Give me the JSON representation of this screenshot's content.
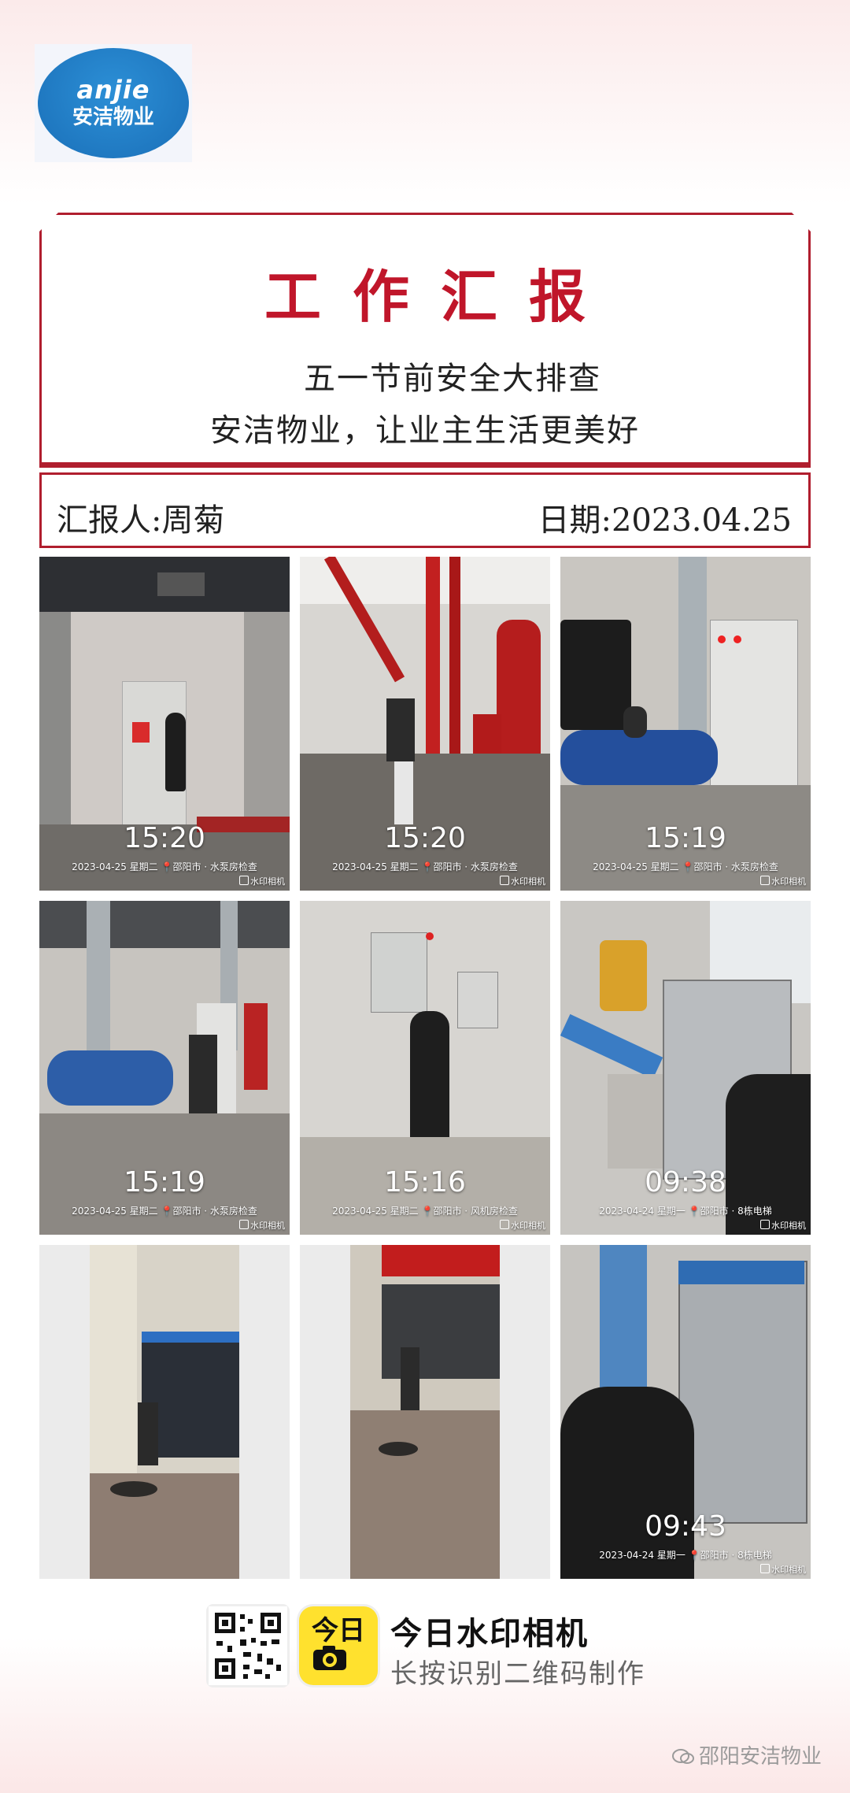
{
  "logo": {
    "en": "anjie",
    "cn": "安洁物业"
  },
  "report": {
    "title": "工作汇报",
    "subtitle": "五一节前安全大排查",
    "slogan": "安洁物业，让业主生活更美好",
    "reporter": "汇报人:周菊",
    "date": "日期:2023.04.25"
  },
  "photos": [
    {
      "time": "15:20",
      "date": "2023-04-25 星期二",
      "location": "邵阳市 · 水泵房检查",
      "watermark": "水印相机"
    },
    {
      "time": "15:20",
      "date": "2023-04-25 星期二",
      "location": "邵阳市 · 水泵房检查",
      "watermark": "水印相机"
    },
    {
      "time": "15:19",
      "date": "2023-04-25 星期二",
      "location": "邵阳市 · 水泵房检查",
      "watermark": "水印相机"
    },
    {
      "time": "15:19",
      "date": "2023-04-25 星期二",
      "location": "邵阳市 · 水泵房检查",
      "watermark": "水印相机"
    },
    {
      "time": "15:16",
      "date": "2023-04-25 星期二",
      "location": "邵阳市 · 风机房检查",
      "watermark": "水印相机"
    },
    {
      "time": "09:38",
      "date": "2023-04-24 星期一",
      "location": "邵阳市 · 8栋电梯",
      "watermark": "水印相机"
    },
    {
      "time": "",
      "date": "",
      "location": "",
      "watermark": ""
    },
    {
      "time": "",
      "date": "",
      "location": "",
      "watermark": ""
    },
    {
      "time": "09:43",
      "date": "2023-04-24 星期一",
      "location": "邵阳市 · 8栋电梯",
      "watermark": "水印相机"
    }
  ],
  "footer": {
    "app_icon_text": "今日",
    "app_name": "今日水印相机",
    "hint": "长按识别二维码制作",
    "account": "邵阳安洁物业"
  },
  "colors": {
    "accent": "#b01e2e",
    "title": "#c0162a",
    "logo_blue": "#1a6fb8",
    "app_yellow": "#ffe12e"
  },
  "icons": [
    "qr-code-icon",
    "camera-app-icon",
    "location-pin-icon",
    "wechat-icon"
  ]
}
